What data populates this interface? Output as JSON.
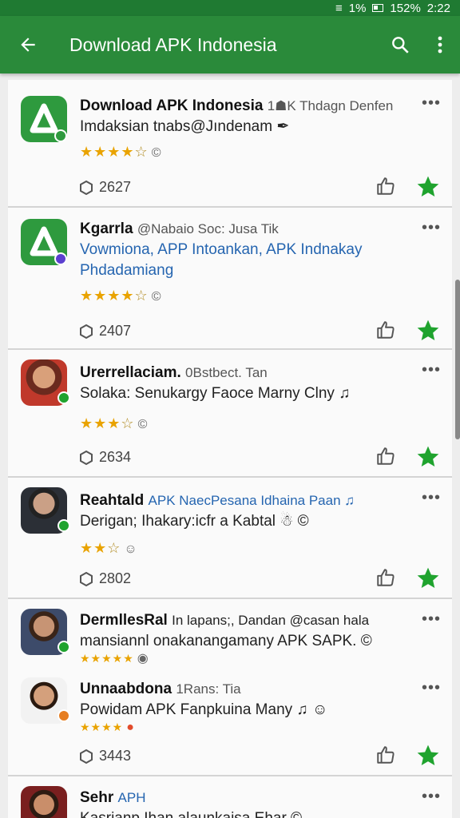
{
  "status": {
    "signal": "1%",
    "battery": "152%",
    "time": "2:22"
  },
  "appbar": {
    "title": "Download APK Indonesia"
  },
  "items": [
    {
      "name": "Download APK Indonesia",
      "sub": "1☗K Thdagn Denfen",
      "desc": "Imdaksian tnabs@Jındenam ✒",
      "stars": "★★★★",
      "hollow": "☆",
      "extra": "©",
      "count": "2627"
    },
    {
      "name": "Kgarrla",
      "sub": "@Nabaio Soc: Jusa Tik",
      "desc": "Vowmiona, APP Intoankan, APK Indnakay Phdadamiang",
      "stars": "★★★★",
      "hollow": "☆",
      "extra": "©",
      "count": "2407"
    },
    {
      "name": "Urerrellaciam.",
      "sub": "0Bstbect. Tan",
      "desc": "Solaka: Senukargy Faoce Marny Clny ♫",
      "stars": "★★★",
      "hollow": "☆",
      "extra": "©",
      "count": "2634"
    },
    {
      "name": "Reahtald",
      "sub": "APK NaecPesana Idhaina Paan ♫",
      "desc": "Derigan; Ihakary:icfr a Kabtal ☃ ©",
      "stars": "★★",
      "hollow": "☆",
      "extra": "☺",
      "count": "2802"
    },
    {
      "name": "DermllesRal",
      "sub": "In lapans;, Dandan @casan hala",
      "desc": "mansiannl onakanangamany APK SAPK. ©",
      "stars": "★★★★★",
      "hollow": "",
      "extra": "◉",
      "count": ""
    },
    {
      "name": "Unnaabdona",
      "sub": "1Rans: Tia",
      "desc": "Powidam APK Fanpkuina Many ♫ ☺",
      "stars": "★★★★",
      "hollow": "",
      "extra": "●",
      "count": "3443"
    },
    {
      "name": "Sehr",
      "sub": "APH",
      "desc": "Kasrianp Ihan alaunkaisa Ehar ©",
      "stars": "",
      "hollow": "",
      "extra": "",
      "count": ""
    }
  ],
  "colors": {
    "primary": "#2a8a3a",
    "accent": "#1fa32e",
    "star": "#e9a300"
  },
  "icons": {
    "back": "arrow-left-icon",
    "search": "search-icon",
    "menu": "more-vert-icon",
    "like": "thumbs-up-icon",
    "fav": "star-icon",
    "more": "more-horiz-icon"
  }
}
